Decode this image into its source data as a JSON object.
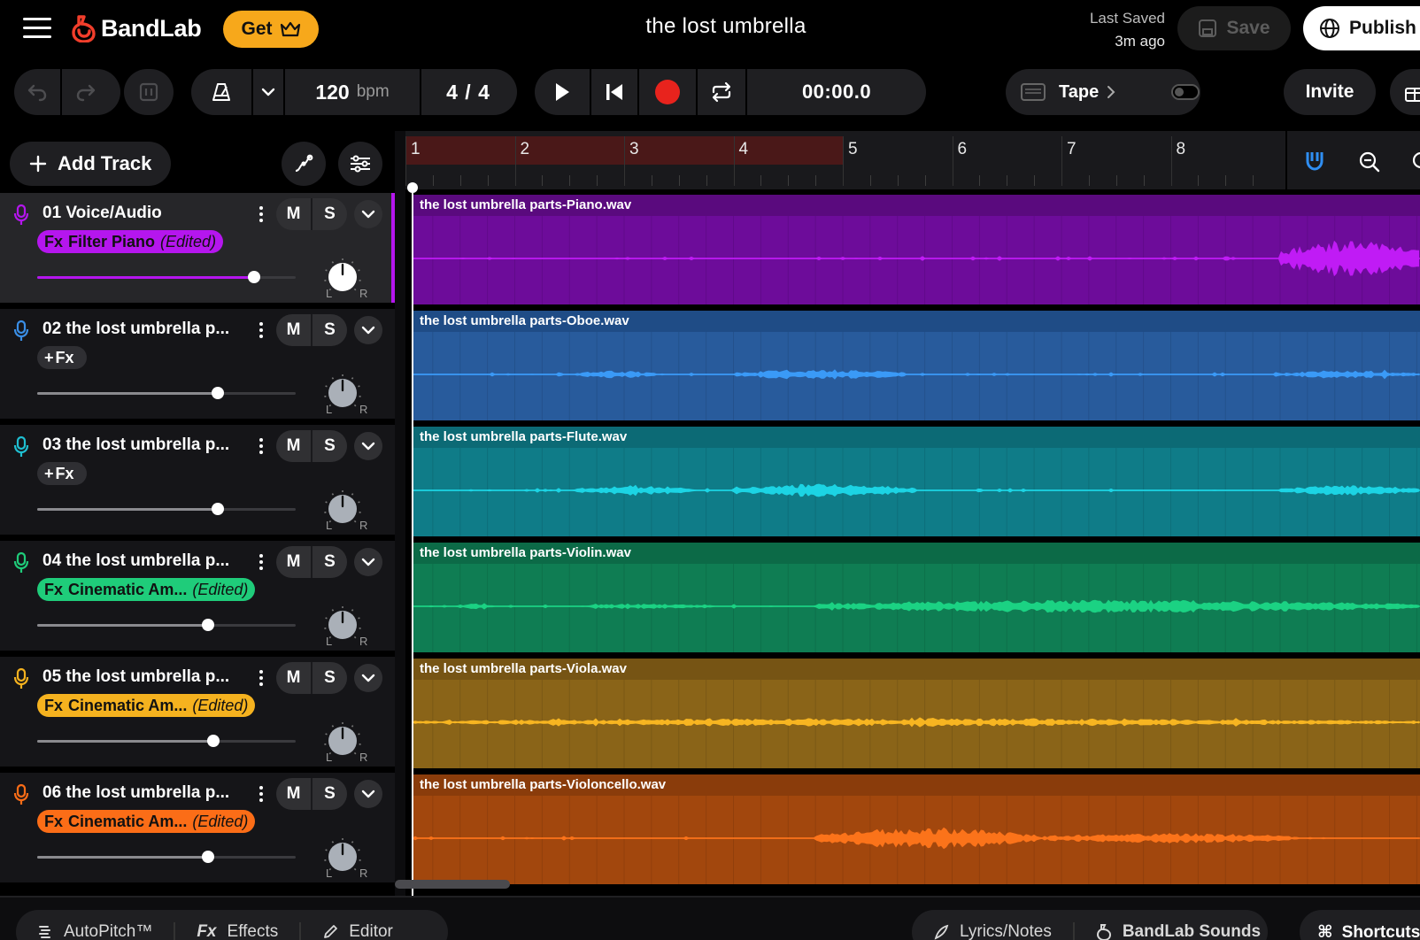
{
  "app": {
    "brand": "BandLab",
    "get_label": "Get",
    "project_title": "the lost umbrella",
    "last_saved_label": "Last Saved",
    "last_saved_time": "3m ago",
    "save_label": "Save",
    "publish_label": "Publish"
  },
  "transport": {
    "bpm_value": "120",
    "bpm_unit": "bpm",
    "time_sig": "4 / 4",
    "timecode": "00:00.0",
    "tape_label": "Tape",
    "tape_enabled": false,
    "invite_label": "Invite"
  },
  "tracks_panel": {
    "add_track_label": "Add Track",
    "tracks": [
      {
        "name": "01  Voice/Audio",
        "color": "#b516ee",
        "fx_prefix": "Fx",
        "fx_name": "Filter Piano",
        "fx_edited": "(Edited)",
        "volume": 0.84,
        "selected": true,
        "mute": "M",
        "solo": "S",
        "pan_L": "L",
        "pan_R": "R"
      },
      {
        "name": "02  the lost umbrella p...",
        "color": "#3a8ee6",
        "fx_prefix": "+",
        "fx_name": "Fx",
        "fx_edited": "",
        "volume": 0.7,
        "selected": false,
        "mute": "M",
        "solo": "S",
        "pan_L": "L",
        "pan_R": "R"
      },
      {
        "name": "03  the lost umbrella p...",
        "color": "#1fbfd1",
        "fx_prefix": "+",
        "fx_name": "Fx",
        "fx_edited": "",
        "volume": 0.7,
        "selected": false,
        "mute": "M",
        "solo": "S",
        "pan_L": "L",
        "pan_R": "R"
      },
      {
        "name": "04  the lost umbrella p...",
        "color": "#1fcc7a",
        "fx_prefix": "Fx",
        "fx_name": "Cinematic Am...",
        "fx_edited": "(Edited)",
        "volume": 0.66,
        "selected": false,
        "mute": "M",
        "solo": "S",
        "pan_L": "L",
        "pan_R": "R"
      },
      {
        "name": "05  the lost umbrella p...",
        "color": "#f5b21f",
        "fx_prefix": "Fx",
        "fx_name": "Cinematic Am...",
        "fx_edited": "(Edited)",
        "volume": 0.68,
        "selected": false,
        "mute": "M",
        "solo": "S",
        "pan_L": "L",
        "pan_R": "R"
      },
      {
        "name": "06  the lost umbrella p...",
        "color": "#fb6d17",
        "fx_prefix": "Fx",
        "fx_name": "Cinematic Am...",
        "fx_edited": "(Edited)",
        "volume": 0.66,
        "selected": false,
        "mute": "M",
        "solo": "S",
        "pan_L": "L",
        "pan_R": "R"
      }
    ]
  },
  "timeline": {
    "bars": [
      "1",
      "2",
      "3",
      "4",
      "5",
      "6",
      "7",
      "8"
    ],
    "loop_bars": [
      1,
      5
    ],
    "clips": [
      {
        "name": "the lost umbrella parts-Piano.wav",
        "header": "#5a0a7e",
        "body": "#6d0c9a",
        "wave": "#c01bf5"
      },
      {
        "name": "the lost umbrella parts-Oboe.wav",
        "header": "#1f4c86",
        "body": "#285b9c",
        "wave": "#3a9af7"
      },
      {
        "name": "the lost umbrella parts-Flute.wav",
        "header": "#0c6a75",
        "body": "#0f7c88",
        "wave": "#1cd4e4"
      },
      {
        "name": "the lost umbrella parts-Violin.wav",
        "header": "#0c6a47",
        "body": "#0f7d53",
        "wave": "#1bd283"
      },
      {
        "name": "the lost umbrella parts-Viola.wav",
        "header": "#765414",
        "body": "#8a6418",
        "wave": "#f7b521"
      },
      {
        "name": "the lost umbrella parts-Violoncello.wav",
        "header": "#8a3c0b",
        "body": "#a2470d",
        "wave": "#fb731a"
      }
    ]
  },
  "bottom": {
    "left_items": [
      "AutoPitch™",
      "Effects",
      "Editor"
    ],
    "effects_prefix": "Fx",
    "right_items": [
      "Lyrics/Notes",
      "BandLab Sounds"
    ],
    "shortcuts_label": "Shortcuts"
  }
}
